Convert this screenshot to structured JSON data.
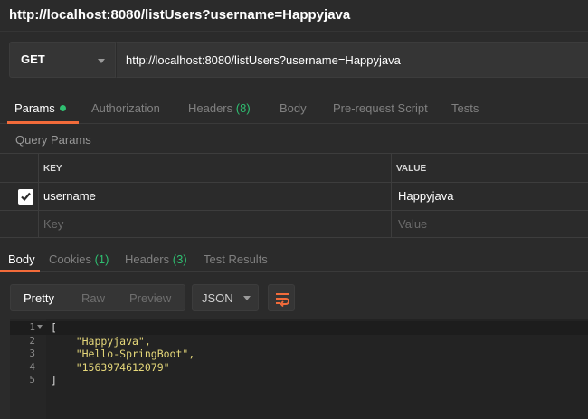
{
  "window": {
    "title": "http://localhost:8080/listUsers?username=Happyjava"
  },
  "request": {
    "method": "GET",
    "url": "http://localhost:8080/listUsers?username=Happyjava"
  },
  "request_tabs": [
    {
      "label": "Params",
      "active": true
    },
    {
      "label": "Authorization"
    },
    {
      "label": "Headers",
      "count": "(8)"
    },
    {
      "label": "Body"
    },
    {
      "label": "Pre-request Script"
    },
    {
      "label": "Tests"
    }
  ],
  "query_params": {
    "section_label": "Query Params",
    "headers": {
      "key": "KEY",
      "value": "VALUE"
    },
    "rows": [
      {
        "checked": true,
        "key": "username",
        "value": "Happyjava"
      }
    ],
    "placeholder": {
      "key": "Key",
      "value": "Value"
    }
  },
  "response_tabs": [
    {
      "label": "Body",
      "active": true
    },
    {
      "label": "Cookies",
      "count": "(1)"
    },
    {
      "label": "Headers",
      "count": "(3)"
    },
    {
      "label": "Test Results"
    }
  ],
  "response_toolbar": {
    "views": [
      "Pretty",
      "Raw",
      "Preview"
    ],
    "active_view": "Pretty",
    "format": "JSON"
  },
  "response_body": {
    "lines": [
      {
        "n": "1",
        "text": "["
      },
      {
        "n": "2",
        "text": "    \"Happyjava\","
      },
      {
        "n": "3",
        "text": "    \"Hello-SpringBoot\","
      },
      {
        "n": "4",
        "text": "    \"1563974612079\""
      },
      {
        "n": "5",
        "text": "]"
      }
    ]
  },
  "colors": {
    "accent": "#f26b3a",
    "count_green": "#2fbf71",
    "string": "#e6d87a",
    "background": "#2b2b2b"
  },
  "icons": [
    "chevron-down-icon",
    "status-dot-icon",
    "check-icon",
    "wrap-lines-icon",
    "fold-icon"
  ]
}
